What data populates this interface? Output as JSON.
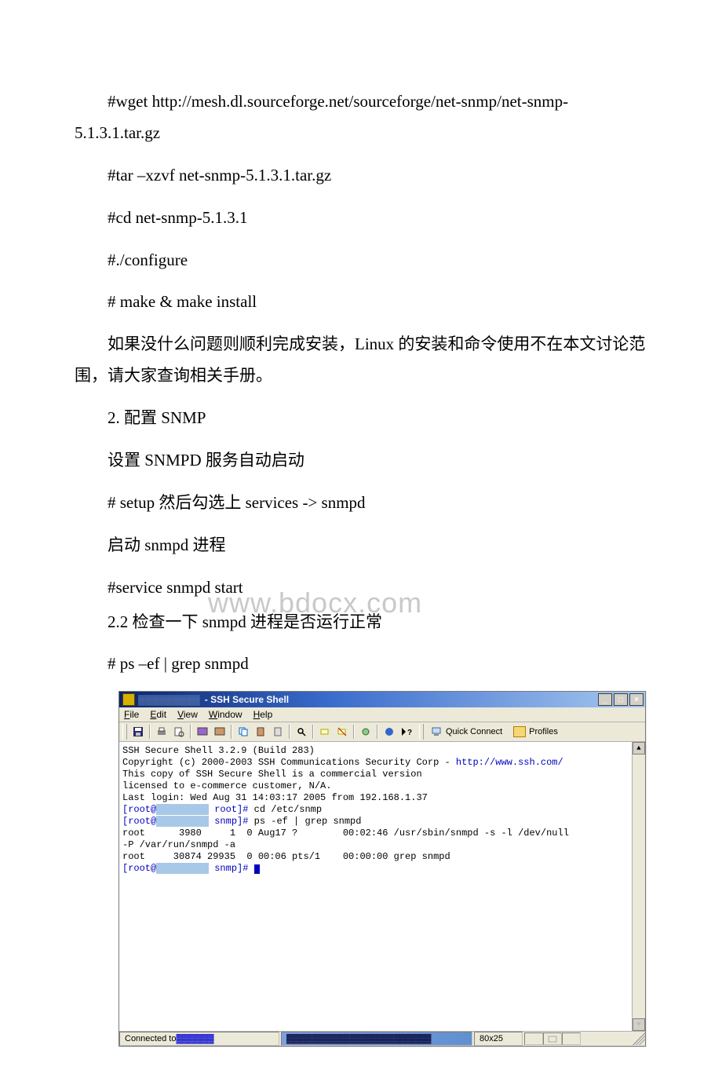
{
  "doc": {
    "p1": "#wget http://mesh.dl.sourceforge.net/sourceforge/net-snmp/net-snmp-5.1.3.1.tar.gz",
    "p1a": "#wget http://mesh.dl.sourceforge.net/sourceforge/net-snmp/net-snmp-",
    "p1b": "5.1.3.1.tar.gz",
    "p2": "#tar –xzvf net-snmp-5.1.3.1.tar.gz",
    "p3": "#cd net-snmp-5.1.3.1",
    "p4": "#./configure",
    "p5": "# make & make install",
    "p6": "如果没什么问题则顺利完成安装，Linux 的安装和命令使用不在本文讨论范围，请大家查询相关手册。",
    "p7": "2. 配置 SNMP",
    "p8": " 设置 SNMPD 服务自动启动",
    "p9": "# setup 然后勾选上 services -> snmpd",
    "p10": "启动 snmpd 进程",
    "p11": "#service snmpd start",
    "p12": "2.2 检查一下 snmpd 进程是否运行正常",
    "p13": "# ps –ef | grep snmpd",
    "watermark": "www.bdocx.com"
  },
  "win": {
    "title_suffix": " - SSH Secure Shell",
    "menus": {
      "file": "File",
      "edit": "Edit",
      "view": "View",
      "window": "Window",
      "help": "Help"
    },
    "toolbar": {
      "quick_connect": "Quick Connect",
      "profiles": "Profiles"
    },
    "terminal": {
      "l1": "SSH Secure Shell 3.2.9 (Build 283)",
      "l2a": "Copyright (c) 2000-2003 SSH Communications Security Corp - ",
      "l2b": "http://www.ssh.com/",
      "l3": "",
      "l4": "This copy of SSH Secure Shell is a commercial version",
      "l5": "licensed to e-commerce customer, N/A.",
      "l6": "",
      "l7": "",
      "l8": "Last login: Wed Aug 31 14:03:17 2005 from 192.168.1.37",
      "l9a": "[root@",
      "l9b": " root]# ",
      "l9c": "cd /etc/snmp",
      "l10a": "[root@",
      "l10b": " snmp]# ",
      "l10c": "ps -ef | grep snmpd",
      "l11": "root      3980     1  0 Aug17 ?        00:02:46 /usr/sbin/snmpd -s -l /dev/null",
      "l12": "-P /var/run/snmpd -a",
      "l13": "root     30874 29935  0 00:06 pts/1    00:00:00 grep snmpd",
      "l14a": "[root@",
      "l14b": " snmp]# "
    },
    "status": {
      "left": "Connected to ",
      "dims": "80x25"
    }
  }
}
